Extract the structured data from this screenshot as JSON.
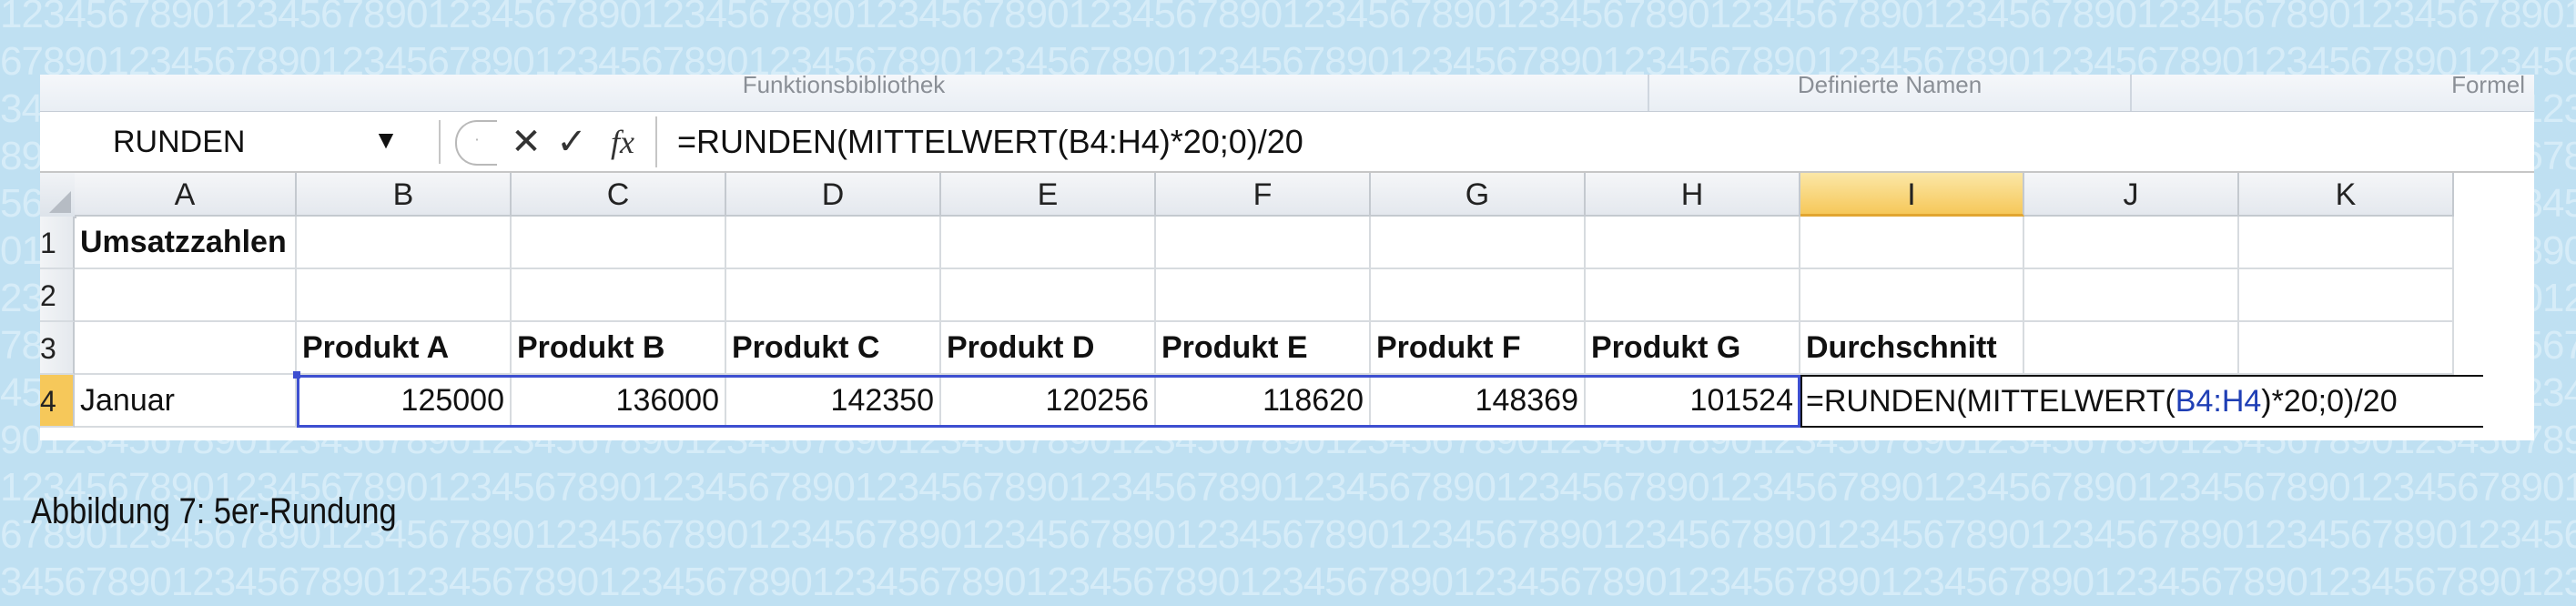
{
  "ribbon": {
    "groups": [
      "Funktionsbibliothek",
      "Definierte Namen",
      "Formel"
    ]
  },
  "formula_bar": {
    "name_box": "RUNDEN",
    "cancel_icon": "✕",
    "enter_icon": "✓",
    "fx_label": "fx",
    "formula": "=RUNDEN(MITTELWERT(B4:H4)*20;0)/20"
  },
  "columns": [
    "A",
    "B",
    "C",
    "D",
    "E",
    "F",
    "G",
    "H",
    "I",
    "J",
    "K"
  ],
  "active_column": "I",
  "rows": [
    {
      "num": "1",
      "cells": {
        "A": "Umsatzzahlen"
      }
    },
    {
      "num": "2",
      "cells": {}
    },
    {
      "num": "3",
      "cells": {
        "B": "Produkt A",
        "C": "Produkt B",
        "D": "Produkt C",
        "E": "Produkt D",
        "F": "Produkt E",
        "G": "Produkt F",
        "H": "Produkt G",
        "I": "Durchschnitt"
      }
    },
    {
      "num": "4",
      "cells": {
        "A": "Januar",
        "B": "125000",
        "C": "136000",
        "D": "142350",
        "E": "120256",
        "F": "118620",
        "G": "148369",
        "H": "101524"
      }
    }
  ],
  "edit_formula": {
    "prefix": "=RUNDEN(MITTELWERT(",
    "ref": "B4:H4",
    "suffix": ")*20;0)/20"
  },
  "caption": "Abbildung 7: 5er-Rundung",
  "background_digits": "1234567890",
  "colors": {
    "background": "#bfe0f2",
    "selection": "#3d4fd0",
    "active_header": "#f6c85a",
    "reference": "#2e7d32"
  }
}
